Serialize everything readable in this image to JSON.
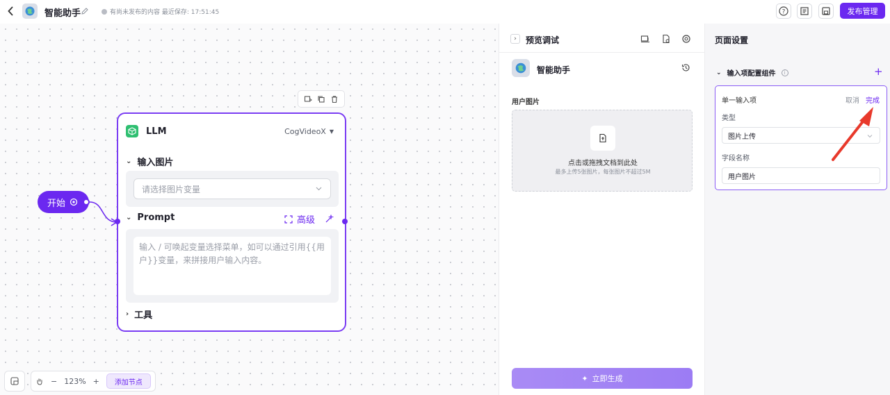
{
  "header": {
    "title": "智能助手",
    "save_status": "有尚未发布的内容  最近保存: 17:51:45",
    "publish_label": "发布管理"
  },
  "canvas": {
    "start_node": {
      "label": "开始"
    },
    "llm_node": {
      "title": "LLM",
      "model": "CogVideoX",
      "image_section": "输入图片",
      "image_placeholder": "请选择图片变量",
      "prompt_section": "Prompt",
      "advanced_label": "高级",
      "prompt_placeholder": "输入 / 可唤起变量选择菜单，如可以通过引用{{用户}}变量，来拼接用户输入内容。",
      "tools_section": "工具"
    },
    "zoom": {
      "level": "123%",
      "add_node_label": "添加节点"
    }
  },
  "preview": {
    "title": "预览调试",
    "app_name": "智能助手",
    "upload_label": "用户图片",
    "upload_main": "点击或拖拽文档到此处",
    "upload_sub": "最多上传5张图片，每张图片不超过5M",
    "generate_label": "立即生成"
  },
  "settings": {
    "title": "页面设置",
    "section": "输入项配置组件",
    "card": {
      "title": "单一输入项",
      "cancel": "取消",
      "done": "完成",
      "type_label": "类型",
      "type_value": "图片上传",
      "field_label": "字段名称",
      "field_value": "用户图片"
    }
  },
  "colors": {
    "accent": "#6b28f0",
    "annotation": "#e8392b"
  }
}
